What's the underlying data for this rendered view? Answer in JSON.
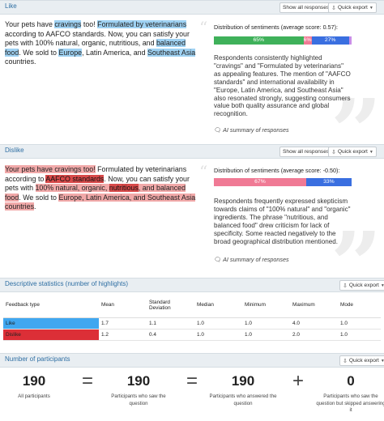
{
  "toolbar": {
    "show_all": "Show all responses",
    "quick_export": "Quick export"
  },
  "like": {
    "title": "Like",
    "passage": [
      {
        "t": "Your pets have ",
        "h": ""
      },
      {
        "t": "cravings",
        "h": "like"
      },
      {
        "t": " too! ",
        "h": ""
      },
      {
        "t": "Formulated by veterinarians",
        "h": "like"
      },
      {
        "t": " according to AAFCO standards. Now, you can satisfy your pets with 100% natural, organic, nutritious, and ",
        "h": ""
      },
      {
        "t": "balanced food",
        "h": "like"
      },
      {
        "t": ". We sold to ",
        "h": ""
      },
      {
        "t": "Europe",
        "h": "like"
      },
      {
        "t": ", Latin America, and ",
        "h": ""
      },
      {
        "t": "Southeast Asia",
        "h": "like"
      },
      {
        "t": " countries.",
        "h": ""
      }
    ],
    "dist_title": "Distribution of sentiments (average score: 0.57):",
    "dist": [
      {
        "label": "65%",
        "value": 65,
        "color": "#3fb15a"
      },
      {
        "label": "6%",
        "value": 6,
        "color": "#f07a95"
      },
      {
        "label": "27%",
        "value": 27,
        "color": "#3a6fe0"
      },
      {
        "label": "",
        "value": 2,
        "color": "#c98ee8"
      }
    ],
    "summary": "Respondents consistently highlighted \"cravings\" and \"Formulated by veterinarians\" as appealing features. The mention of \"AAFCO standards\" and international availability in \"Europe, Latin America, and Southeast Asia\" also resonated strongly, suggesting consumers value both quality assurance and global recognition.",
    "ai_note": "AI summary of responses"
  },
  "dislike": {
    "title": "Dislike",
    "passage": [
      {
        "t": "Your pets have cravings too!",
        "h": "dis"
      },
      {
        "t": " Formulated by veterinarians according to ",
        "h": ""
      },
      {
        "t": "AAFCO standards",
        "h": "dis2"
      },
      {
        "t": ". Now, you can satisfy your pets with ",
        "h": ""
      },
      {
        "t": "100% natural, organic, ",
        "h": "dis"
      },
      {
        "t": "nutritious",
        "h": "dis2"
      },
      {
        "t": ", and balanced food",
        "h": "dis"
      },
      {
        "t": ". We sold to ",
        "h": ""
      },
      {
        "t": "Europe, Latin America, and Southeast Asia countries",
        "h": "dis"
      },
      {
        "t": ".",
        "h": ""
      }
    ],
    "dist_title": "Distribution of sentiments (average score: -0.50):",
    "dist": [
      {
        "label": "67%",
        "value": 67,
        "color": "#f07a95"
      },
      {
        "label": "33%",
        "value": 33,
        "color": "#3a6fe0"
      }
    ],
    "summary": "Respondents frequently expressed skepticism towards claims of \"100% natural\" and \"organic\" ingredients. The phrase \"nutritious, and balanced food\" drew criticism for lack of specificity. Some reacted negatively to the broad geographical distribution mentioned.",
    "ai_note": "AI summary of responses"
  },
  "stats": {
    "title": "Descriptive statistics (number of highlights)",
    "quick_export": "Quick export",
    "headers": [
      "Feedback type",
      "Mean",
      "Standard Deviation",
      "Median",
      "Minimum",
      "Maximum",
      "Mode"
    ],
    "rows": [
      {
        "type": "Like",
        "cells": [
          "1.7",
          "1.1",
          "1.0",
          "1.0",
          "4.0",
          "1.0"
        ],
        "color": "#40a7f0"
      },
      {
        "type": "Dislike",
        "cells": [
          "1.2",
          "0.4",
          "1.0",
          "1.0",
          "2.0",
          "1.0"
        ],
        "color": "#dc2f37"
      }
    ]
  },
  "participants": {
    "title": "Number of participants",
    "quick_export": "Quick export",
    "items": [
      {
        "value": "190",
        "caption": "All participants"
      },
      {
        "value": "190",
        "caption": "Participants who saw the question"
      },
      {
        "value": "190",
        "caption": "Participants who answered the question"
      },
      {
        "value": "0",
        "caption": "Participants who saw the question but skipped answering it"
      }
    ],
    "operators": [
      "=",
      "=",
      "+"
    ]
  },
  "icons": {
    "table": "table-icon",
    "export": "export-icon",
    "ai": "ai-summary-icon",
    "quote": "quote-icon"
  }
}
